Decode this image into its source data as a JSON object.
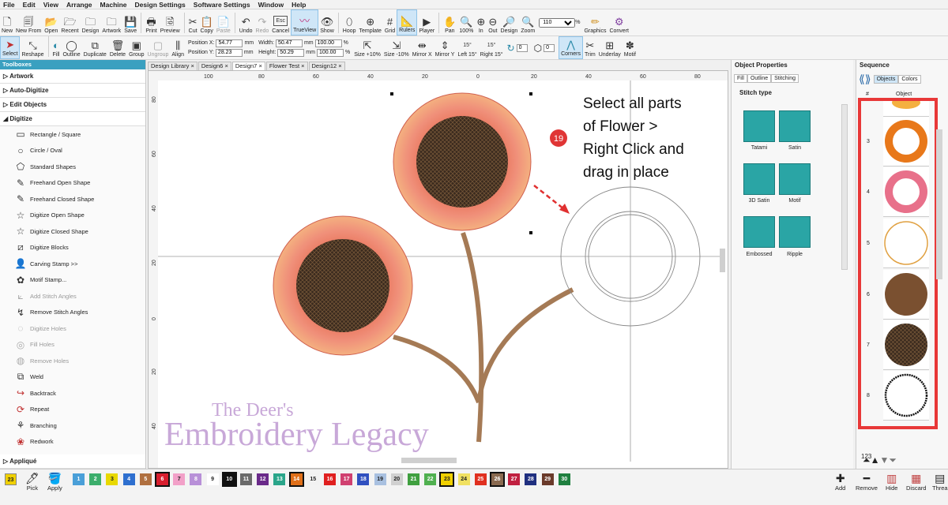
{
  "menu": [
    "File",
    "Edit",
    "View",
    "Arrange",
    "Machine",
    "Design Settings",
    "Software Settings",
    "Window",
    "Help"
  ],
  "toolbar1": {
    "new": "New",
    "new_from": "New From",
    "open": "Open",
    "recent": "Recent",
    "design": "Design",
    "artwork": "Artwork",
    "save": "Save",
    "print": "Print",
    "preview": "Preview",
    "cut": "Cut",
    "copy": "Copy",
    "paste": "Paste",
    "undo": "Undo",
    "redo": "Redo",
    "cancel": "Cancel",
    "trueview": "TrueView",
    "show": "Show",
    "hoop": "Hoop",
    "template": "Template",
    "grid": "Grid",
    "rulers": "Rulers",
    "player": "Player",
    "pan": "Pan",
    "zoom100": "100%",
    "zoom_in": "In",
    "zoom_out": "Out",
    "zoom_design": "Design",
    "zoom": "Zoom",
    "zoom_value": "110",
    "zoom_unit": "%",
    "graphics": "Graphics",
    "convert": "Convert",
    "esc": "Esc"
  },
  "toolbar2": {
    "select": "Select",
    "reshape": "Reshape",
    "fill": "Fill",
    "outline": "Outline",
    "duplicate": "Duplicate",
    "delete": "Delete",
    "group": "Group",
    "ungroup": "Ungroup",
    "align": "Align",
    "pos_x_label": "Position X:",
    "pos_x": "54.77",
    "pos_y_label": "Position Y:",
    "pos_y": "28.23",
    "mm": "mm",
    "width_label": "Width:",
    "width": "50.47",
    "height_label": "Height:",
    "height": "50.29",
    "pct_w": "100.00",
    "pct_h": "100.00",
    "pct": "%",
    "size_up": "Size +10%",
    "size_down": "Size -10%",
    "mirror_x": "Mirror X",
    "mirror_y": "Mirror Y",
    "left15": "Left 15°",
    "right15": "Right 15°",
    "deg15": "15°",
    "rot_val": "0",
    "rot_val2": "0",
    "corners": "Corners",
    "trim": "Trim",
    "underlay": "Underlay",
    "motif": "Motif"
  },
  "toolboxes": {
    "title": "Toolboxes",
    "groups": [
      "Artwork",
      "Auto-Digitize",
      "Edit Objects",
      "Digitize"
    ],
    "tools": [
      "Rectangle / Square",
      "Circle / Oval",
      "Standard Shapes",
      "Freehand Open Shape",
      "Freehand Closed Shape",
      "Digitize Open Shape",
      "Digitize Closed Shape",
      "Digitize Blocks",
      "Carving Stamp >>",
      "Motif Stamp...",
      "Add Stitch Angles",
      "Remove Stitch Angles",
      "Digitize Holes",
      "Fill Holes",
      "Remove Holes",
      "Weld",
      "Backtrack",
      "Repeat",
      "Branching",
      "Redwork"
    ],
    "last_group": "Appliqué"
  },
  "tabs": [
    "Design Library",
    "Design6",
    "Design7",
    "Flower Test",
    "Design12"
  ],
  "ruler_marks": [
    "100",
    "80",
    "60",
    "40",
    "20",
    "0",
    "20",
    "40",
    "60",
    "80"
  ],
  "ruler_v": [
    "80",
    "60",
    "40",
    "20",
    "0",
    "20",
    "40"
  ],
  "annotation": {
    "step": "19",
    "line1": "Select all parts",
    "line2": "of Flower >",
    "line3": "Right Click and",
    "line4": "drag in place"
  },
  "watermark": {
    "line1": "The Deer's",
    "line2": "Embroidery Legacy"
  },
  "object_properties": {
    "title": "Object Properties",
    "tabs": [
      "Fill",
      "Outline",
      "Stitching"
    ],
    "section": "Stitch type",
    "types": [
      "Tatami",
      "Satin",
      "3D Satin",
      "Motif",
      "Embossed",
      "Ripple"
    ]
  },
  "sequence": {
    "title": "Sequence",
    "tabs": [
      "Objects",
      "Colors"
    ],
    "col_num": "#",
    "col_obj": "Object",
    "rows": [
      "3",
      "4",
      "5",
      "6",
      "7",
      "8"
    ],
    "count": "123"
  },
  "colors": {
    "palette": [
      {
        "n": "1",
        "c": "#4a9fd8"
      },
      {
        "n": "2",
        "c": "#3cae6c"
      },
      {
        "n": "3",
        "c": "#e8d800"
      },
      {
        "n": "4",
        "c": "#2e6fcf"
      },
      {
        "n": "5",
        "c": "#b07040"
      },
      {
        "n": "6",
        "c": "#d81e2e"
      },
      {
        "n": "7",
        "c": "#f2a0c8"
      },
      {
        "n": "8",
        "c": "#b890d8"
      },
      {
        "n": "9",
        "c": "#ffffff"
      },
      {
        "n": "10",
        "c": "#111111"
      },
      {
        "n": "11",
        "c": "#6a6a6a"
      },
      {
        "n": "12",
        "c": "#6a2a8a"
      },
      {
        "n": "13",
        "c": "#2aa58a"
      },
      {
        "n": "14",
        "c": "#e0701a"
      },
      {
        "n": "15",
        "c": "#f2f2f2"
      },
      {
        "n": "16",
        "c": "#e02020"
      },
      {
        "n": "17",
        "c": "#d04070"
      },
      {
        "n": "18",
        "c": "#3050c0"
      },
      {
        "n": "19",
        "c": "#a8c0e0"
      },
      {
        "n": "20",
        "c": "#d0d0d0"
      },
      {
        "n": "21",
        "c": "#40a040"
      },
      {
        "n": "22",
        "c": "#50b050"
      },
      {
        "n": "23",
        "c": "#f0d000"
      },
      {
        "n": "24",
        "c": "#f0e060"
      },
      {
        "n": "25",
        "c": "#e03020"
      },
      {
        "n": "26",
        "c": "#8a6a50"
      },
      {
        "n": "27",
        "c": "#c02040"
      },
      {
        "n": "28",
        "c": "#203080"
      },
      {
        "n": "29",
        "c": "#6a3a2a"
      },
      {
        "n": "30",
        "c": "#208040"
      }
    ],
    "current": "23",
    "pick": "Pick",
    "apply": "Apply"
  },
  "bottom_actions": {
    "add": "Add",
    "remove": "Remove",
    "hide": "Hide",
    "discard": "Discard",
    "threads": "Threa"
  }
}
